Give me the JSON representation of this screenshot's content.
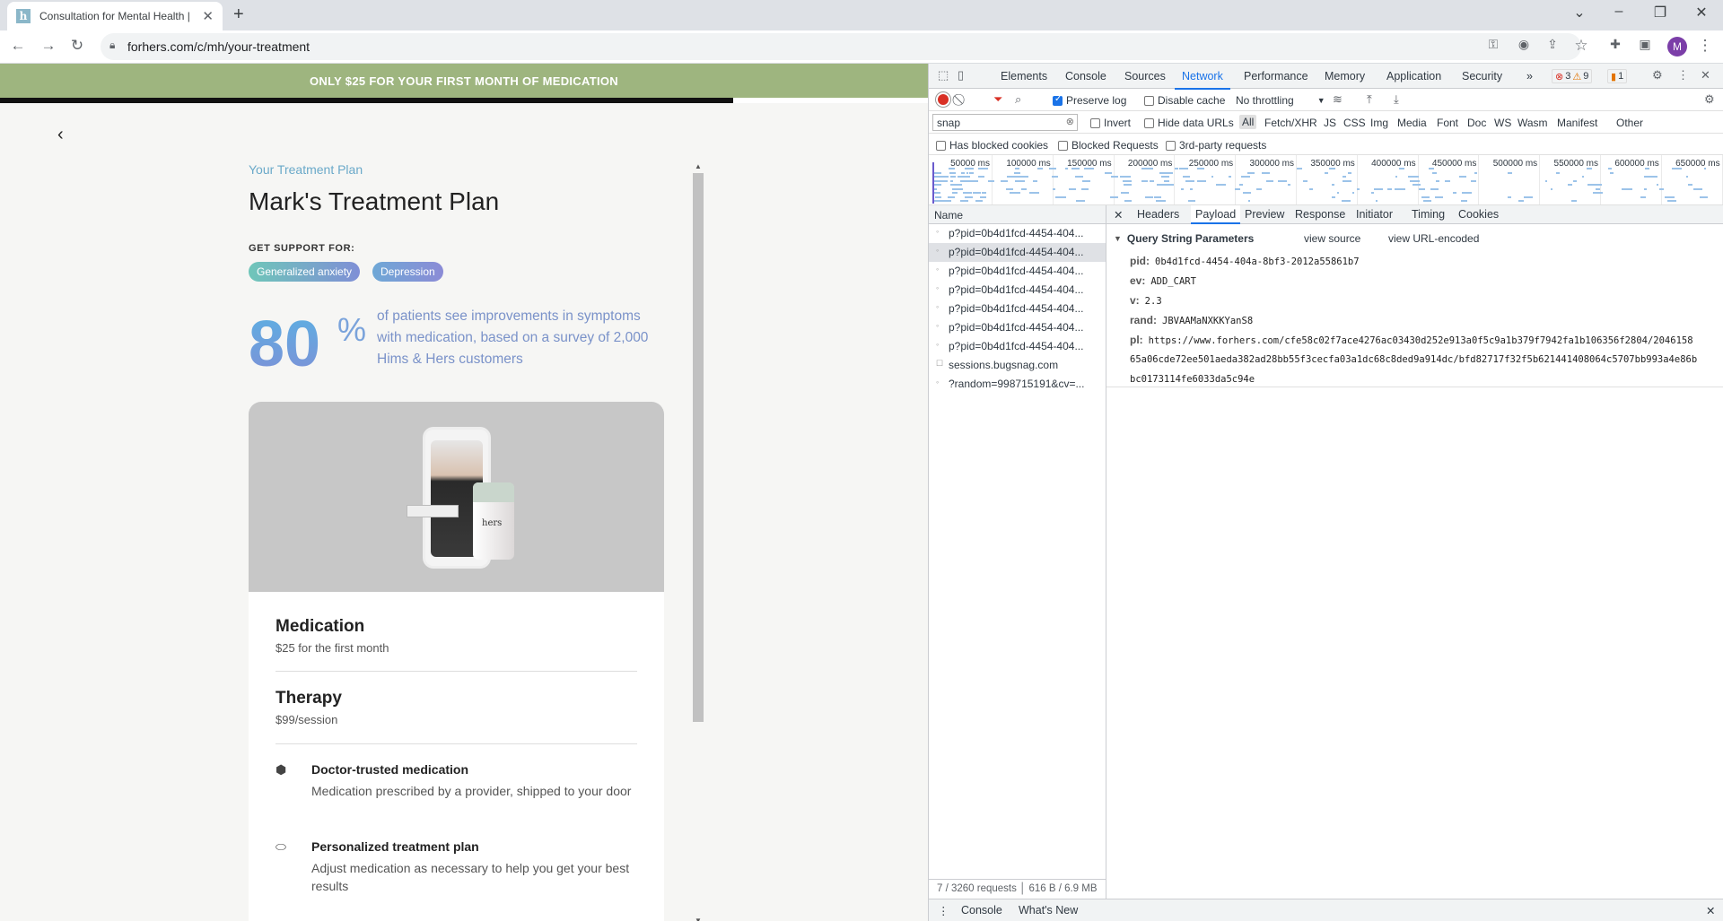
{
  "browser": {
    "tab_title": "Consultation for Mental Health | ",
    "favicon_letter": "h",
    "new_tab": "+",
    "url": "forhers.com/c/mh/your-treatment",
    "profile_initial": "M"
  },
  "page": {
    "banner": "ONLY $25 FOR YOUR FIRST MONTH OF MEDICATION",
    "progress": 0.79,
    "subtitle": "Your Treatment Plan",
    "title": "Mark's Treatment Plan",
    "support_label": "GET SUPPORT FOR:",
    "chips": [
      "Generalized anxiety",
      "Depression"
    ],
    "stat_number": "80",
    "stat_percent": "%",
    "stat_text": "of patients see improvements in symptoms with medication, based on a survey of 2,000 Hims & Hers customers",
    "bottle_label": "hers",
    "items": [
      {
        "title": "Medication",
        "subtitle": "$25 for the first month"
      },
      {
        "title": "Therapy",
        "subtitle": "$99/session"
      }
    ],
    "features": [
      {
        "title": "Doctor-trusted medication",
        "desc": "Medication prescribed by a provider, shipped to your door"
      },
      {
        "title": "Personalized treatment plan",
        "desc": "Adjust medication as necessary to help you get your best results"
      }
    ]
  },
  "devtools": {
    "tabs": [
      "Elements",
      "Console",
      "Sources",
      "Network",
      "Performance",
      "Memory",
      "Application",
      "Security"
    ],
    "active_tab": "Network",
    "errors": "3",
    "warnings": "9",
    "issues": "1",
    "toolbar": {
      "preserve_log": "Preserve log",
      "disable_cache": "Disable cache",
      "throttling": "No throttling"
    },
    "filter_value": "snap",
    "filter_options": [
      "Invert",
      "Hide data URLs"
    ],
    "filter_types": [
      "All",
      "Fetch/XHR",
      "JS",
      "CSS",
      "Img",
      "Media",
      "Font",
      "Doc",
      "WS",
      "Wasm",
      "Manifest",
      "Other"
    ],
    "blocked_options": [
      "Has blocked cookies",
      "Blocked Requests",
      "3rd-party requests"
    ],
    "timeline_ticks": [
      "50000 ms",
      "100000 ms",
      "150000 ms",
      "200000 ms",
      "250000 ms",
      "300000 ms",
      "350000 ms",
      "400000 ms",
      "450000 ms",
      "500000 ms",
      "550000 ms",
      "600000 ms",
      "650000 ms"
    ],
    "name_header": "Name",
    "requests": [
      "p?pid=0b4d1fcd-4454-404...",
      "p?pid=0b4d1fcd-4454-404...",
      "p?pid=0b4d1fcd-4454-404...",
      "p?pid=0b4d1fcd-4454-404...",
      "p?pid=0b4d1fcd-4454-404...",
      "p?pid=0b4d1fcd-4454-404...",
      "p?pid=0b4d1fcd-4454-404...",
      "sessions.bugsnag.com",
      "?random=998715191&cv=..."
    ],
    "selected_request": 1,
    "footer": "7 / 3260 requests",
    "footer_size": "616 B / 6.9 MB",
    "detail_tabs": [
      "Headers",
      "Payload",
      "Preview",
      "Response",
      "Initiator",
      "Timing",
      "Cookies"
    ],
    "detail_active": "Payload",
    "qs_header": "Query String Parameters",
    "view_source": "view source",
    "view_url_encoded": "view URL-encoded",
    "params": {
      "pid": "0b4d1fcd-4454-404a-8bf3-2012a55861b7",
      "ev": "ADD_CART",
      "v": "2.3",
      "rand": "JBVAAMaNXKKYanS8",
      "pl_line1": "https://www.forhers.com/cfe58c02f7ace4276ac03430d252e913a0f5c9a1b379f7942fa1b106356f2804/2046158",
      "pl_line2": "65a06cde72ee501aeda382ad28bb55f3cecfa03a1dc68c8ded9a914dc/bfd82717f32f5b621441408064c5707bb993a4e86b",
      "pl_line3": "bc0173114fe6033da5c94e"
    },
    "drawer_tabs": [
      "Console",
      "What's New"
    ]
  },
  "icons": {
    "back": "arrow-left-icon",
    "forward": "arrow-right-icon",
    "reload": "reload-icon",
    "lock": "lock-icon"
  }
}
